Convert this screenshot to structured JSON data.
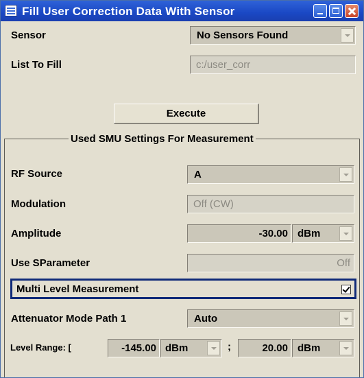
{
  "window": {
    "title": "Fill User Correction Data With Sensor"
  },
  "sensor": {
    "label": "Sensor",
    "value": "No Sensors Found"
  },
  "list_to_fill": {
    "label": "List To Fill",
    "value": "c:/user_corr"
  },
  "execute": {
    "label": "Execute"
  },
  "group": {
    "title": "Used SMU Settings For Measurement"
  },
  "rf_source": {
    "label": "RF Source",
    "value": "A"
  },
  "modulation": {
    "label": "Modulation",
    "value": "Off (CW)"
  },
  "amplitude": {
    "label": "Amplitude",
    "value": "-30.00",
    "unit": "dBm"
  },
  "use_sparameter": {
    "label": "Use SParameter",
    "value": "Off"
  },
  "multi_level": {
    "label": "Multi Level Measurement",
    "checked": true
  },
  "attenuator": {
    "label": "Attenuator Mode Path 1",
    "value": "Auto"
  },
  "level_range": {
    "label": "Level Range: [",
    "min_value": "-145.00",
    "min_unit": "dBm",
    "separator": ";",
    "max_value": "20.00",
    "max_unit": "dBm"
  }
}
